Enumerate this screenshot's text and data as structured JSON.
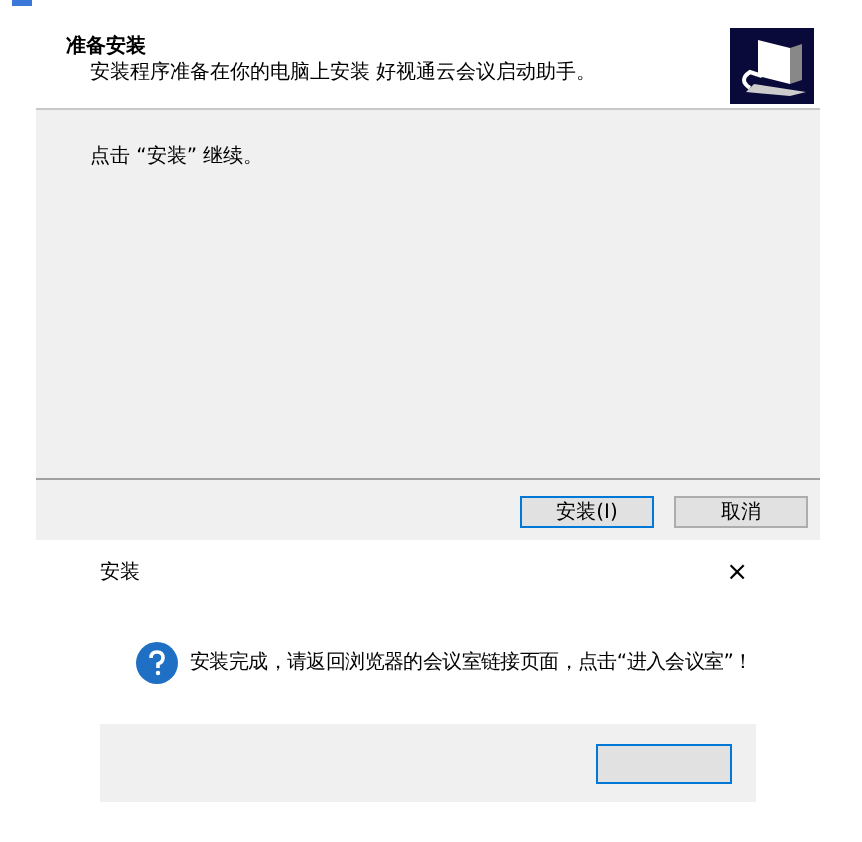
{
  "setup": {
    "heading": "准备安装",
    "subheading": "安装程序准备在你的电脑上安装 好视通云会议启动助手。",
    "body": "点击 “安装” 继续。",
    "buttons": [
      {
        "label": "安装(I)",
        "selected": true
      },
      {
        "label": "取消",
        "selected": false
      }
    ]
  },
  "message_box": {
    "title": "安装",
    "close": "×",
    "message": "安装完成，请返回浏览器的会议室链接页面，点击“进入会议室”！",
    "buttons": [
      {
        "selected": true
      }
    ]
  }
}
